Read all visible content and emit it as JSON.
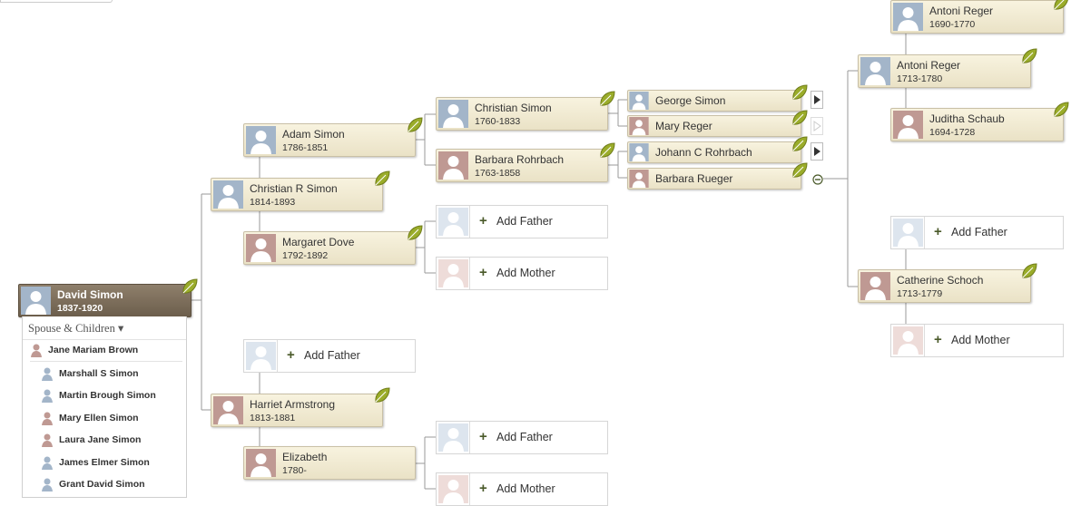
{
  "colors": {
    "male": "#a3b5c9",
    "female": "#bf9993",
    "leaf": "#9aac2a",
    "root": "#7b6c59"
  },
  "root": {
    "name": "David Simon",
    "dates": "1837-1920"
  },
  "spouse_panel": {
    "header": "Spouse & Children ▾",
    "spouse": {
      "name": "Jane Mariam Brown",
      "gender": "female"
    },
    "children": [
      {
        "name": "Marshall S Simon",
        "gender": "male"
      },
      {
        "name": "Martin Brough Simon",
        "gender": "male"
      },
      {
        "name": "Mary Ellen Simon",
        "gender": "female"
      },
      {
        "name": "Laura Jane Simon",
        "gender": "female"
      },
      {
        "name": "James Elmer Simon",
        "gender": "male"
      },
      {
        "name": "Grant David Simon",
        "gender": "male"
      }
    ]
  },
  "people": {
    "christian_r_simon": {
      "name": "Christian R Simon",
      "dates": "1814-1893"
    },
    "harriet_armstrong": {
      "name": "Harriet Armstrong",
      "dates": "1813-1881"
    },
    "adam_simon": {
      "name": "Adam Simon",
      "dates": "1786-1851"
    },
    "margaret_dove": {
      "name": "Margaret Dove",
      "dates": "1792-1892"
    },
    "elizabeth": {
      "name": "Elizabeth",
      "dates": "1780-"
    },
    "christian_simon": {
      "name": "Christian Simon",
      "dates": "1760-1833"
    },
    "barbara_rohrbach": {
      "name": "Barbara Rohrbach",
      "dates": "1763-1858"
    },
    "george_simon": {
      "name": "George Simon"
    },
    "mary_reger": {
      "name": "Mary Reger"
    },
    "johann_c_rohrbach": {
      "name": "Johann C Rohrbach"
    },
    "barbara_rueger": {
      "name": "Barbara Rueger"
    },
    "antoni_reger_1713": {
      "name": "Antoni Reger",
      "dates": "1713-1780"
    },
    "catherine_schoch": {
      "name": "Catherine Schoch",
      "dates": "1713-1779"
    },
    "antoni_reger_1690": {
      "name": "Antoni Reger",
      "dates": "1690-1770"
    },
    "juditha_schaub": {
      "name": "Juditha Schaub",
      "dates": "1694-1728"
    }
  },
  "labels": {
    "add_father": "Add Father",
    "add_mother": "Add Mother",
    "plus": "+"
  }
}
